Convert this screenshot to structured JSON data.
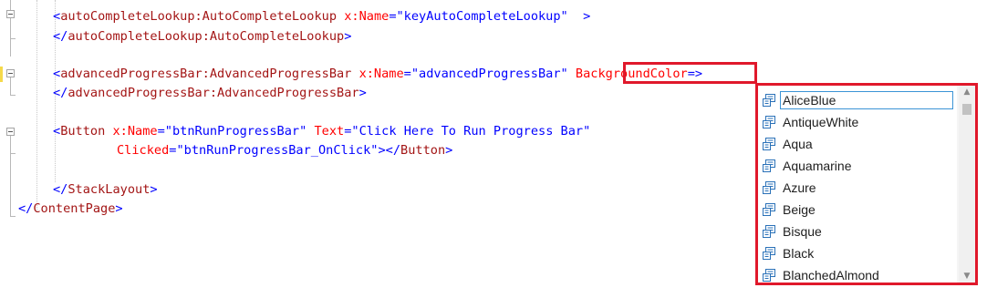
{
  "colors": {
    "tag": "#a31515",
    "bracket": "#0000ff",
    "attr": "#ff0000",
    "value": "#0000ff",
    "highlight": "#e0182b"
  },
  "code": {
    "line1": {
      "open": "<",
      "tag": "autoCompleteLookup:AutoCompleteLookup",
      "attr": "x:Name",
      "eq": "=",
      "val": "\"keyAutoCompleteLookup\"",
      "close": "  >"
    },
    "line2": {
      "open": "</",
      "tag": "autoCompleteLookup:AutoCompleteLookup",
      "close": ">"
    },
    "line3": {
      "open": "<",
      "tag": "advancedProgressBar:AdvancedProgressBar",
      "attr": "x:Name",
      "eq": "=",
      "val": "\"advancedProgressBar\"",
      "attr2": "BackgroundColor",
      "eq2": "=",
      "close": ">"
    },
    "line4": {
      "open": "</",
      "tag": "advancedProgressBar:AdvancedProgressBar",
      "close": ">"
    },
    "line5": {
      "open": "<",
      "tag": "Button",
      "attr": "x:Name",
      "eq": "=",
      "val": "\"btnRunProgressBar\"",
      "attr2": "Text",
      "eq2": "=",
      "val2": "\"Click Here To Run Progress Bar\""
    },
    "line6": {
      "attr": "Clicked",
      "eq": "=",
      "val": "\"btnRunProgressBar_OnClick\"",
      "close1": ">",
      "open2": "</",
      "tag": "Button",
      "close2": ">"
    },
    "line7": {
      "open": "</",
      "tag": "StackLayout",
      "close": ">"
    },
    "line8": {
      "open": "</",
      "tag": "ContentPage",
      "close": ">"
    }
  },
  "completion": {
    "icon": "enum-value-icon",
    "items": [
      "AliceBlue",
      "AntiqueWhite",
      "Aqua",
      "Aquamarine",
      "Azure",
      "Beige",
      "Bisque",
      "Black",
      "BlanchedAlmond"
    ],
    "selected": "AliceBlue"
  }
}
